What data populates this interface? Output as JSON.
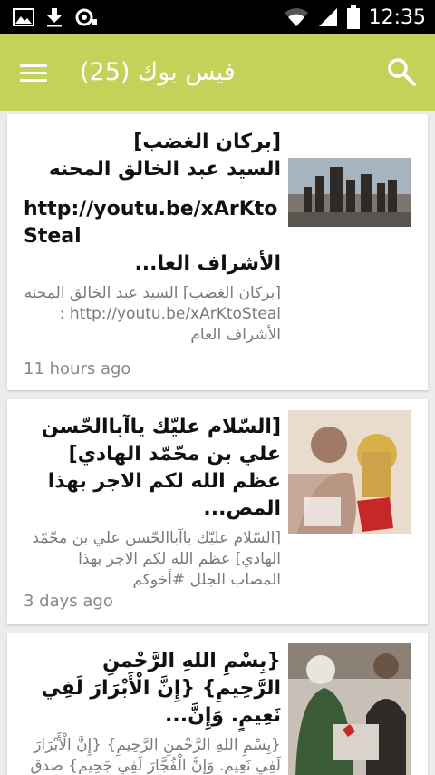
{
  "status_bar": {
    "time": "12:35",
    "left_icons": [
      "image-icon",
      "download-icon",
      "sync-icon"
    ],
    "right_icons": [
      "wifi-icon",
      "signal-icon",
      "battery-icon"
    ]
  },
  "app_bar": {
    "title": "فيس بوك (25)",
    "background": "#c3d35a",
    "menu_icon": "menu-icon",
    "search_icon": "search-icon"
  },
  "posts": [
    {
      "title_line1": "[بركان الغضب]",
      "title_line2": "السيد عبد الخالق المحنه",
      "title_url": "http://youtu.be/xArKtoSteal",
      "title_line3": "الأشراف العا...",
      "excerpt": "[بركان الغضب] السيد عبد الخالق المحنه http://youtu.be/xArKtoSteal : الأشراف العام",
      "time": "11 hours ago"
    },
    {
      "title": "[السّلام عليّك ياآباالحّسن علي بن محّمّد الهادي] عظم الله لكم الاجر بهذا المص...",
      "excerpt": "[السّلام عليّك ياآباالحّسن علي بن محّمّد الهادي] عظم الله لكم الاجر بهذا المصاب الجلل #أخوكم",
      "time": "3 days ago"
    },
    {
      "title": "{بِسْمِ اللهِ الرَّحْمنِ الرَّحِيمِ} {إِنَّ الْأَبْرَارَ لَفِي نَعِيمٍ. وَإِنَّ...",
      "excerpt": "{بِسْمِ اللهِ الرَّحْمنِ الرَّحِيمِ} {إِنَّ الْأَبْرَارَ لَفِي نَعِيمٍ. وَإِنَّ الْفُجَّارَ لَفِي جَحِيمٍ} صدق الله العلي العظيم",
      "time": ""
    }
  ]
}
